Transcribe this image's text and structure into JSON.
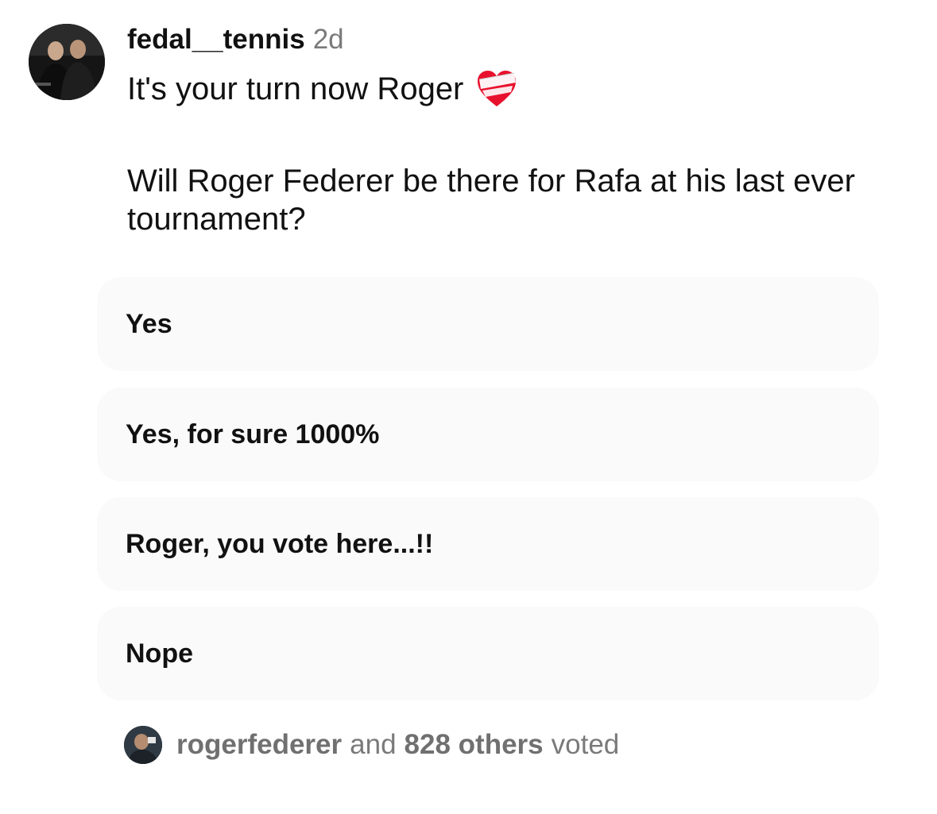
{
  "post": {
    "username": "fedal__tennis",
    "time": "2d",
    "caption": "It's your turn now Roger",
    "caption_icon": "mending-heart-icon",
    "question": "Will Roger Federer be there for Rafa at his last ever tournament?"
  },
  "poll": {
    "options": [
      {
        "label": "Yes"
      },
      {
        "label": "Yes, for sure 1000%"
      },
      {
        "label": "Roger, you vote here...!!"
      },
      {
        "label": "Nope"
      }
    ]
  },
  "voters": {
    "user": "rogerfederer",
    "and_text": "and",
    "others": "828 others",
    "suffix": "voted"
  },
  "colors": {
    "option_bg": "#fafafa",
    "muted_text": "#7a7a7a",
    "heart_red": "#e8112d"
  }
}
